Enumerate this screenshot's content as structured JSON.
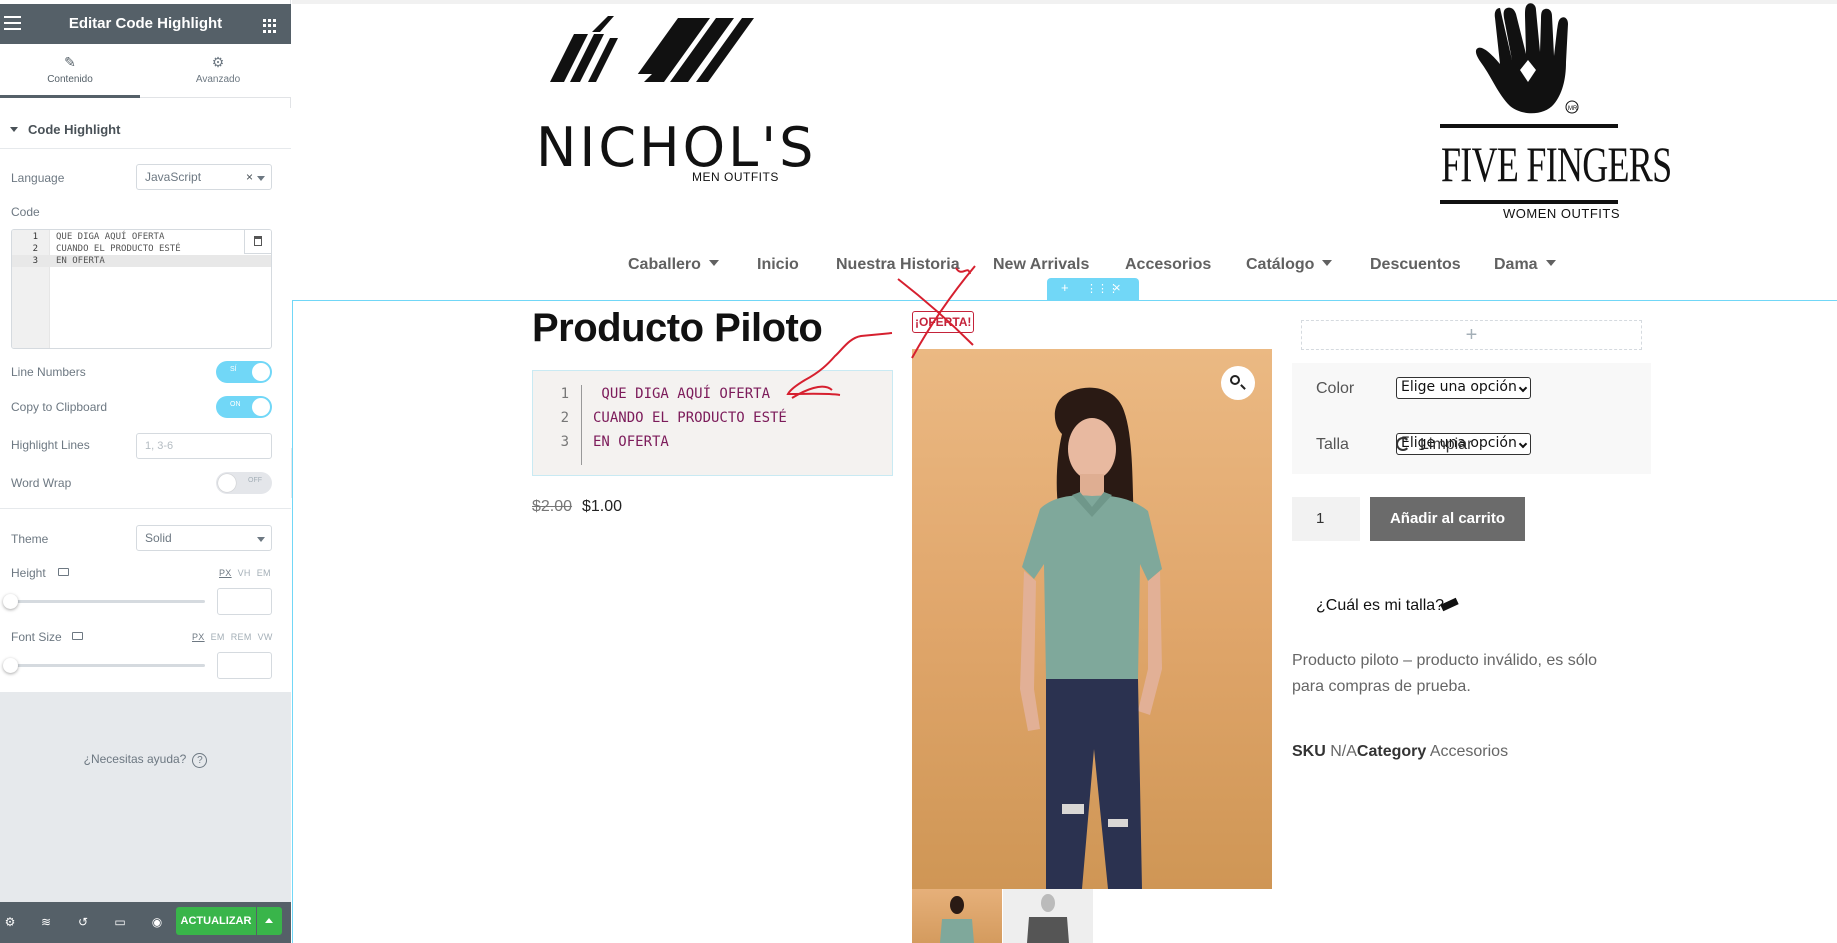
{
  "panel": {
    "title": "Editar Code Highlight",
    "tabs": [
      {
        "label": "Contenido",
        "icon": "pencil-icon"
      },
      {
        "label": "Avanzado",
        "icon": "gear-icon"
      }
    ],
    "section_title": "Code Highlight",
    "language": {
      "label": "Language",
      "value": "JavaScript",
      "clear": "×"
    },
    "code": {
      "label": "Code",
      "lines": [
        {
          "num": "1",
          "text": "QUE DIGA AQUÍ OFERTA"
        },
        {
          "num": "2",
          "text": "CUANDO EL PRODUCTO ESTÉ"
        },
        {
          "num": "3",
          "text": "EN OFERTA"
        }
      ]
    },
    "line_numbers": {
      "label": "Line Numbers",
      "state": "SÍ"
    },
    "copy_clipboard": {
      "label": "Copy to Clipboard",
      "state": "ON"
    },
    "highlight_lines": {
      "label": "Highlight Lines",
      "placeholder": "1, 3-6"
    },
    "word_wrap": {
      "label": "Word Wrap",
      "state": "OFF"
    },
    "theme": {
      "label": "Theme",
      "value": "Solid"
    },
    "height": {
      "label": "Height",
      "units": [
        "PX",
        "VH",
        "EM"
      ]
    },
    "font_size": {
      "label": "Font Size",
      "units": [
        "PX",
        "EM",
        "REM",
        "VW"
      ]
    },
    "help": {
      "label": "¿Necesitas ayuda?",
      "icon": "?"
    },
    "footer": {
      "update_label": "ACTUALIZAR"
    },
    "accent_color": "#71d7f7",
    "header_color": "#556068",
    "update_color": "#39b54a"
  },
  "site": {
    "logo_left": {
      "name": "NICHOL'S",
      "sub": "MEN OUTFITS"
    },
    "logo_right": {
      "name": "FIVE FINGERS",
      "mark": "MR",
      "sub": "WOMEN OUTFITS"
    },
    "nav": [
      {
        "label": "Caballero",
        "dropdown": true
      },
      {
        "label": "Inicio",
        "dropdown": false
      },
      {
        "label": "Nuestra Historia",
        "dropdown": false
      },
      {
        "label": "New Arrivals",
        "dropdown": false
      },
      {
        "label": "Accesorios",
        "dropdown": false
      },
      {
        "label": "Catálogo",
        "dropdown": true
      },
      {
        "label": "Descuentos",
        "dropdown": false
      },
      {
        "label": "Dama",
        "dropdown": true
      }
    ]
  },
  "product": {
    "title": "Producto Piloto",
    "code_lines": [
      {
        "num": "1",
        "text": " QUE DIGA AQUÍ OFERTA"
      },
      {
        "num": "2",
        "text": "CUANDO EL PRODUCTO ESTÉ"
      },
      {
        "num": "3",
        "text": "EN OFERTA"
      }
    ],
    "price_old": "$2.00",
    "price_new": "$1.00",
    "badge": "¡OFERTA!",
    "add_widget": "+",
    "color_label": "Color",
    "size_label": "Talla",
    "select_placeholder": "Elige una opción",
    "clear_label": "Limpiar",
    "qty": "1",
    "add_to_cart": "Añadir al carrito",
    "size_question": "¿Cuál es mi talla?",
    "description": "Producto piloto – producto inválido, es sólo para compras de prueba.",
    "sku_label": "SKU",
    "sku_value": "N/A",
    "category_label": "Category",
    "category_value": "Accesorios",
    "badge_color": "#c4233a",
    "code_text_color": "#7c1b5a"
  }
}
